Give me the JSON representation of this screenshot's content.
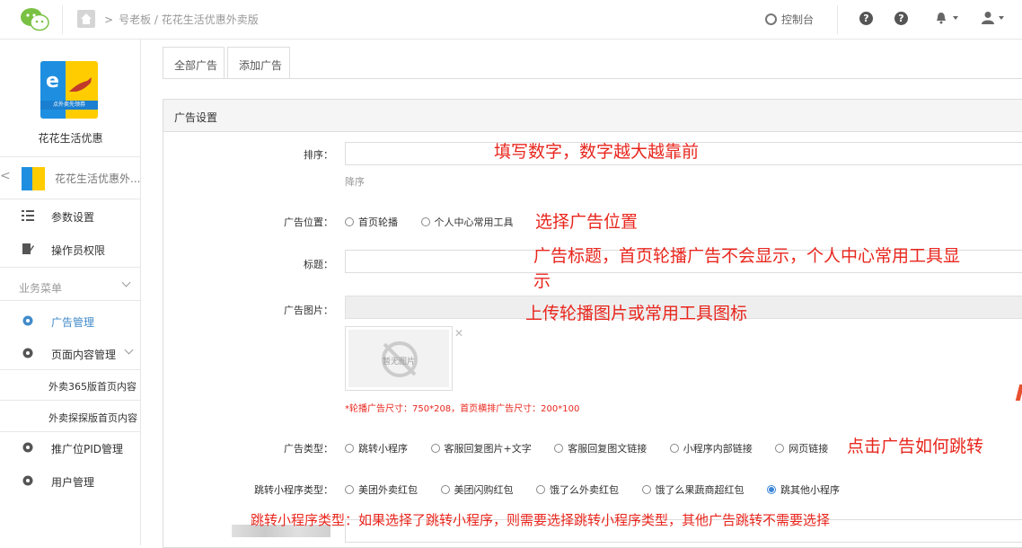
{
  "topbar": {
    "breadcrumb": "号老板 / 花花生活优惠外卖版",
    "console_label": "控制台",
    "help_icons": [
      "?",
      "?"
    ]
  },
  "sidebar": {
    "app_name": "花花生活优惠",
    "logo_text": "e",
    "logo_band": "点外卖先领券",
    "back_item_label": "花花生活优惠外...",
    "items": [
      {
        "label": "参数设置",
        "icon": "list-icon"
      },
      {
        "label": "操作员权限",
        "icon": "edit-icon"
      }
    ],
    "section_title": "业务菜单",
    "menu": [
      {
        "label": "广告管理",
        "active": true,
        "icon": "gear-icon"
      },
      {
        "label": "页面内容管理",
        "active": false,
        "icon": "gear-icon"
      }
    ],
    "sub_items": [
      "外卖365版首页内容",
      "外卖探探版首页内容"
    ],
    "menu2": [
      {
        "label": "推广位PID管理",
        "icon": "gear-icon"
      },
      {
        "label": "用户管理",
        "icon": "gear-icon"
      }
    ]
  },
  "tabs": [
    "全部广告",
    "添加广告"
  ],
  "panel": {
    "title": "广告设置",
    "sort_label": "排序：",
    "sort_value": "",
    "sort_help": "降序",
    "position_label": "广告位置：",
    "position_options": [
      "首页轮播",
      "个人中心常用工具"
    ],
    "title_label": "标题：",
    "title_value": "",
    "image_label": "广告图片：",
    "no_image_text": "暂无图片",
    "image_size_note": "*轮播广告尺寸：750*208，首页横排广告尺寸：200*100",
    "type_label": "广告类型：",
    "type_options": [
      "跳转小程序",
      "客服回复图片+文字",
      "客服回复图文链接",
      "小程序内部链接",
      "网页链接"
    ],
    "mini_type_label": "跳转小程序类型：",
    "mini_type_options": [
      "美团外卖红包",
      "美团闪购红包",
      "饿了么外卖红包",
      "饿了么果蔬商超红包",
      "跳其他小程序"
    ],
    "mini_type_selected": 4
  },
  "annotations": {
    "sort": "填写数字，数字越大越靠前",
    "position": "选择广告位置",
    "title_line1": "广告标题，首页轮播广告不会显示，个人中心常用工具显",
    "title_line2": "示",
    "image": "上传轮播图片或常用工具图标",
    "type": "点击广告如何跳转",
    "mini_type": "跳转小程序类型：如果选择了跳转小程序，则需要选择跳转小程序类型，其他广告跳转不需要选择"
  },
  "colors": {
    "accent": "#428bca",
    "annotation": "#e8261d",
    "radio_checked": "#3b86d9"
  }
}
